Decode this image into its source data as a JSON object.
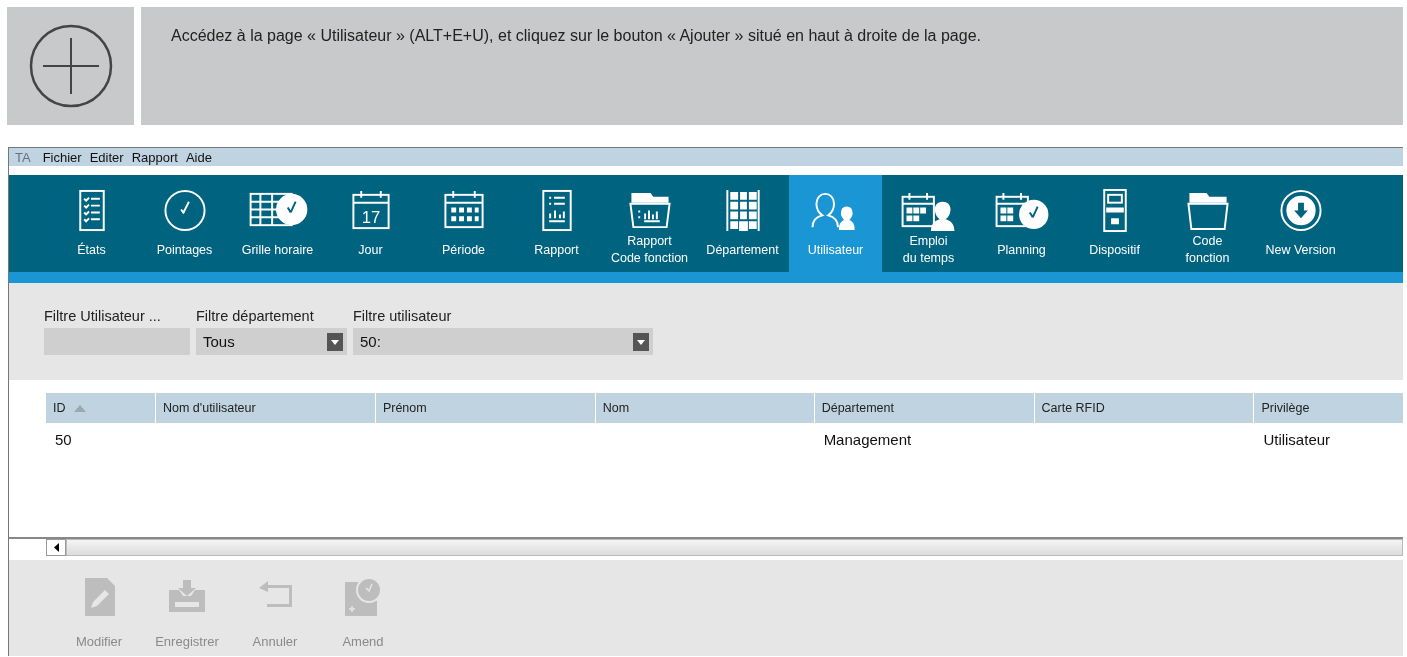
{
  "instruction": {
    "text": "Accédez à la page « Utilisateur » (ALT+E+U), et cliquez sur le bouton « Ajouter » situé en haut à droite de la page."
  },
  "window": {
    "app_label": "TA"
  },
  "menu": [
    "Fichier",
    "Editer",
    "Rapport",
    "Aide"
  ],
  "toolbar": [
    {
      "label": "États",
      "selected": false
    },
    {
      "label": "Pointages",
      "selected": false
    },
    {
      "label": "Grille horaire",
      "selected": false
    },
    {
      "label": "Jour",
      "selected": false,
      "icon_number": "17"
    },
    {
      "label": "Période",
      "selected": false
    },
    {
      "label": "Rapport",
      "selected": false
    },
    {
      "label": "Rapport\nCode fonction",
      "selected": false
    },
    {
      "label": "Département",
      "selected": false
    },
    {
      "label": "Utilisateur",
      "selected": true
    },
    {
      "label": "Emploi\ndu temps",
      "selected": false
    },
    {
      "label": "Planning",
      "selected": false
    },
    {
      "label": "Dispositif",
      "selected": false
    },
    {
      "label": "Code\nfonction",
      "selected": false
    },
    {
      "label": "New Version",
      "selected": false
    }
  ],
  "filters": [
    {
      "label": "Filtre Utilisateur ...",
      "kind": "text"
    },
    {
      "label": "Filtre département",
      "kind": "dropdown",
      "value": "Tous"
    },
    {
      "label": "Filtre utilisateur",
      "kind": "dropdown",
      "value": "50:"
    }
  ],
  "table": {
    "columns": [
      "ID",
      "Nom d'utilisateur",
      "Prénom",
      "Nom",
      "Département",
      "Carte RFID",
      "Privilège"
    ],
    "rows": [
      [
        "50",
        "",
        "",
        "",
        "Management",
        "",
        "Utilisateur"
      ]
    ]
  },
  "actions": [
    {
      "label": "Modifier",
      "disabled": true
    },
    {
      "label": "Enregistrer",
      "disabled": true
    },
    {
      "label": "Annuler",
      "disabled": true
    },
    {
      "label": "Amend",
      "disabled": true
    }
  ]
}
